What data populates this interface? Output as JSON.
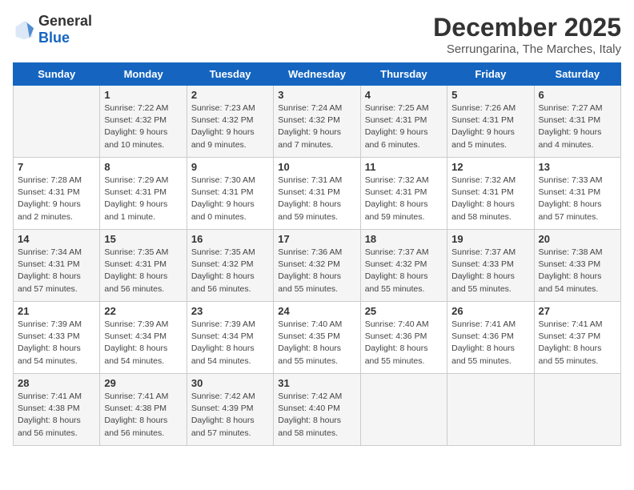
{
  "logo": {
    "general": "General",
    "blue": "Blue"
  },
  "title": "December 2025",
  "subtitle": "Serrungarina, The Marches, Italy",
  "weekdays": [
    "Sunday",
    "Monday",
    "Tuesday",
    "Wednesday",
    "Thursday",
    "Friday",
    "Saturday"
  ],
  "weeks": [
    [
      {
        "day": "",
        "info": ""
      },
      {
        "day": "1",
        "info": "Sunrise: 7:22 AM\nSunset: 4:32 PM\nDaylight: 9 hours\nand 10 minutes."
      },
      {
        "day": "2",
        "info": "Sunrise: 7:23 AM\nSunset: 4:32 PM\nDaylight: 9 hours\nand 9 minutes."
      },
      {
        "day": "3",
        "info": "Sunrise: 7:24 AM\nSunset: 4:32 PM\nDaylight: 9 hours\nand 7 minutes."
      },
      {
        "day": "4",
        "info": "Sunrise: 7:25 AM\nSunset: 4:31 PM\nDaylight: 9 hours\nand 6 minutes."
      },
      {
        "day": "5",
        "info": "Sunrise: 7:26 AM\nSunset: 4:31 PM\nDaylight: 9 hours\nand 5 minutes."
      },
      {
        "day": "6",
        "info": "Sunrise: 7:27 AM\nSunset: 4:31 PM\nDaylight: 9 hours\nand 4 minutes."
      }
    ],
    [
      {
        "day": "7",
        "info": "Sunrise: 7:28 AM\nSunset: 4:31 PM\nDaylight: 9 hours\nand 2 minutes."
      },
      {
        "day": "8",
        "info": "Sunrise: 7:29 AM\nSunset: 4:31 PM\nDaylight: 9 hours\nand 1 minute."
      },
      {
        "day": "9",
        "info": "Sunrise: 7:30 AM\nSunset: 4:31 PM\nDaylight: 9 hours\nand 0 minutes."
      },
      {
        "day": "10",
        "info": "Sunrise: 7:31 AM\nSunset: 4:31 PM\nDaylight: 8 hours\nand 59 minutes."
      },
      {
        "day": "11",
        "info": "Sunrise: 7:32 AM\nSunset: 4:31 PM\nDaylight: 8 hours\nand 59 minutes."
      },
      {
        "day": "12",
        "info": "Sunrise: 7:32 AM\nSunset: 4:31 PM\nDaylight: 8 hours\nand 58 minutes."
      },
      {
        "day": "13",
        "info": "Sunrise: 7:33 AM\nSunset: 4:31 PM\nDaylight: 8 hours\nand 57 minutes."
      }
    ],
    [
      {
        "day": "14",
        "info": "Sunrise: 7:34 AM\nSunset: 4:31 PM\nDaylight: 8 hours\nand 57 minutes."
      },
      {
        "day": "15",
        "info": "Sunrise: 7:35 AM\nSunset: 4:31 PM\nDaylight: 8 hours\nand 56 minutes."
      },
      {
        "day": "16",
        "info": "Sunrise: 7:35 AM\nSunset: 4:32 PM\nDaylight: 8 hours\nand 56 minutes."
      },
      {
        "day": "17",
        "info": "Sunrise: 7:36 AM\nSunset: 4:32 PM\nDaylight: 8 hours\nand 55 minutes."
      },
      {
        "day": "18",
        "info": "Sunrise: 7:37 AM\nSunset: 4:32 PM\nDaylight: 8 hours\nand 55 minutes."
      },
      {
        "day": "19",
        "info": "Sunrise: 7:37 AM\nSunset: 4:33 PM\nDaylight: 8 hours\nand 55 minutes."
      },
      {
        "day": "20",
        "info": "Sunrise: 7:38 AM\nSunset: 4:33 PM\nDaylight: 8 hours\nand 54 minutes."
      }
    ],
    [
      {
        "day": "21",
        "info": "Sunrise: 7:39 AM\nSunset: 4:33 PM\nDaylight: 8 hours\nand 54 minutes."
      },
      {
        "day": "22",
        "info": "Sunrise: 7:39 AM\nSunset: 4:34 PM\nDaylight: 8 hours\nand 54 minutes."
      },
      {
        "day": "23",
        "info": "Sunrise: 7:39 AM\nSunset: 4:34 PM\nDaylight: 8 hours\nand 54 minutes."
      },
      {
        "day": "24",
        "info": "Sunrise: 7:40 AM\nSunset: 4:35 PM\nDaylight: 8 hours\nand 55 minutes."
      },
      {
        "day": "25",
        "info": "Sunrise: 7:40 AM\nSunset: 4:36 PM\nDaylight: 8 hours\nand 55 minutes."
      },
      {
        "day": "26",
        "info": "Sunrise: 7:41 AM\nSunset: 4:36 PM\nDaylight: 8 hours\nand 55 minutes."
      },
      {
        "day": "27",
        "info": "Sunrise: 7:41 AM\nSunset: 4:37 PM\nDaylight: 8 hours\nand 55 minutes."
      }
    ],
    [
      {
        "day": "28",
        "info": "Sunrise: 7:41 AM\nSunset: 4:38 PM\nDaylight: 8 hours\nand 56 minutes."
      },
      {
        "day": "29",
        "info": "Sunrise: 7:41 AM\nSunset: 4:38 PM\nDaylight: 8 hours\nand 56 minutes."
      },
      {
        "day": "30",
        "info": "Sunrise: 7:42 AM\nSunset: 4:39 PM\nDaylight: 8 hours\nand 57 minutes."
      },
      {
        "day": "31",
        "info": "Sunrise: 7:42 AM\nSunset: 4:40 PM\nDaylight: 8 hours\nand 58 minutes."
      },
      {
        "day": "",
        "info": ""
      },
      {
        "day": "",
        "info": ""
      },
      {
        "day": "",
        "info": ""
      }
    ]
  ]
}
